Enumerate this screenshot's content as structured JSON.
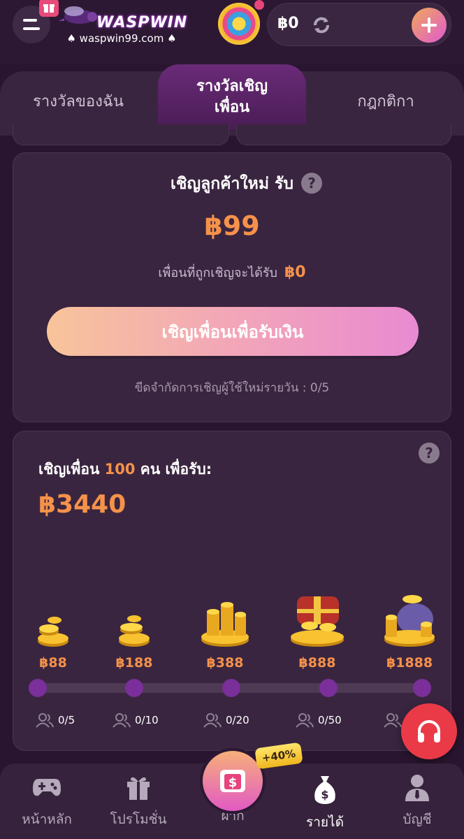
{
  "header": {
    "logo_text": "WASPWIN",
    "site_url": "♠ waspwin99.com ♠",
    "balance": "฿0"
  },
  "tabs": [
    {
      "label": "รางวัลของฉัน"
    },
    {
      "label": "รางวัลเชิญเพื่อน"
    },
    {
      "label": "กฎกติกา"
    }
  ],
  "invite_card": {
    "title": "เชิญลูกค้าใหม่ รับ",
    "reward": "฿99",
    "friend_gets_label": "เพื่อนที่ถูกเชิญจะได้รับ",
    "friend_gets_value": "฿0",
    "button_label": "เชิญเพื่อนเพื่อรับเงิน",
    "daily_limit": "ขีดจำกัดการเชิญผู้ใช้ใหม่รายวัน : 0/5"
  },
  "milestone_card": {
    "title_prefix": "เชิญเพื่อน",
    "title_count": "100",
    "title_suffix": "คน เพื่อรับ:",
    "total": "฿3440",
    "tiers": [
      {
        "amount": "฿88",
        "progress": "0/5"
      },
      {
        "amount": "฿188",
        "progress": "0/10"
      },
      {
        "amount": "฿388",
        "progress": "0/20"
      },
      {
        "amount": "฿888",
        "progress": "0/50"
      },
      {
        "amount": "฿1888",
        "progress": "0/"
      }
    ]
  },
  "bottom_nav": [
    {
      "label": "หน้าหลัก",
      "icon": "gamepad-icon"
    },
    {
      "label": "โปรโมชั่น",
      "icon": "gift-icon"
    },
    {
      "label": "ฝาก",
      "icon": "deposit-icon"
    },
    {
      "label": "รายได้",
      "icon": "money-bag-icon"
    },
    {
      "label": "บัญชี",
      "icon": "user-icon"
    }
  ],
  "deposit_badge": "+40%",
  "colors": {
    "background": "#2a1530",
    "card": "#3a2540",
    "accent_orange": "#f5924a",
    "accent_pink": "#e05ad0",
    "support_red": "#ea3a48"
  }
}
